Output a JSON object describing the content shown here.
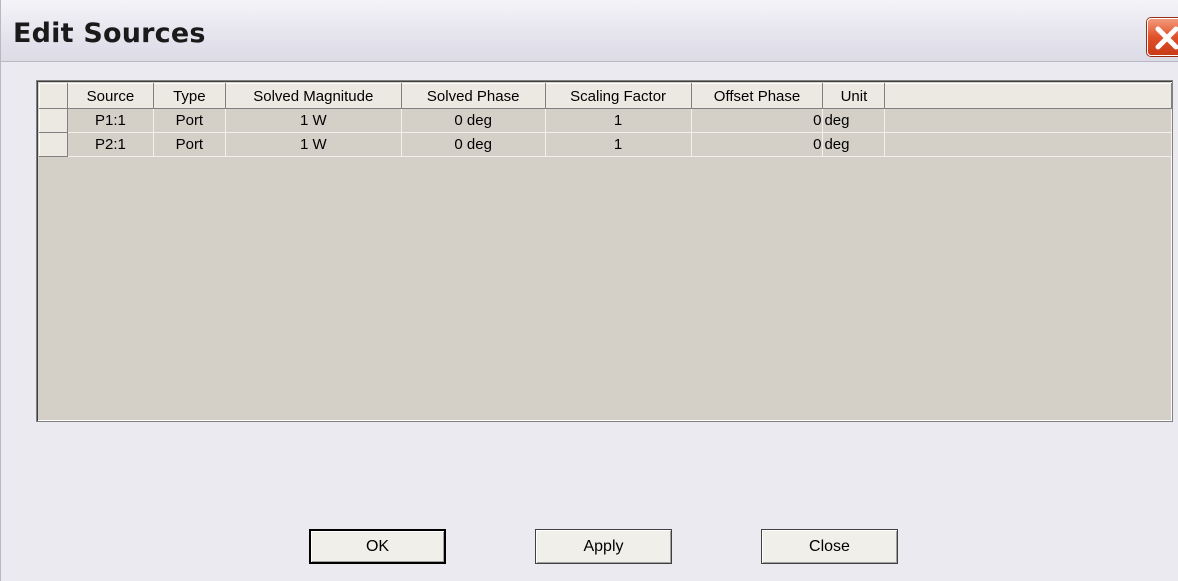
{
  "window": {
    "title": "Edit Sources"
  },
  "grid": {
    "columns": [
      "",
      "Source",
      "Type",
      "Solved Magnitude",
      "Solved Phase",
      "Scaling Factor",
      "Offset Phase",
      "Unit"
    ],
    "rows": [
      {
        "source": "P1:1",
        "type": "Port",
        "solved_magnitude": "1 W",
        "solved_phase": "0 deg",
        "scaling_factor": "1",
        "offset_phase": "0",
        "unit": "deg"
      },
      {
        "source": "P2:1",
        "type": "Port",
        "solved_magnitude": "1 W",
        "solved_phase": "0 deg",
        "scaling_factor": "1",
        "offset_phase": "0",
        "unit": "deg"
      }
    ]
  },
  "buttons": {
    "ok": "OK",
    "apply": "Apply",
    "close": "Close"
  },
  "icons": {
    "close": "close-x-icon"
  },
  "colors": {
    "close_button": "#e0512a",
    "grid_background": "#d4d0c8",
    "window_background": "#ebeaf0"
  }
}
